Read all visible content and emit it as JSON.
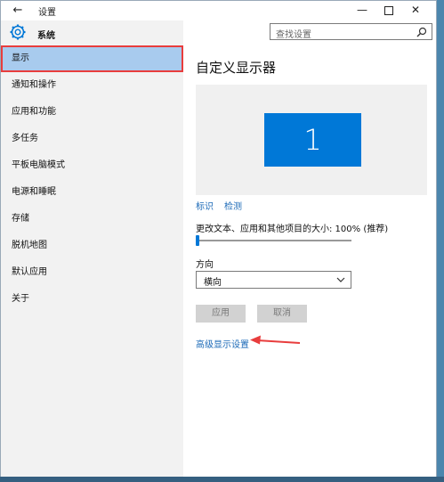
{
  "window": {
    "title": "设置",
    "back_icon": "arrow-left-icon",
    "controls": {
      "minimize": "—",
      "close": "✕"
    }
  },
  "sidebar": {
    "section_title": "系统",
    "section_icon": "gear-icon",
    "items": [
      {
        "label": "显示",
        "selected": true
      },
      {
        "label": "通知和操作"
      },
      {
        "label": "应用和功能"
      },
      {
        "label": "多任务"
      },
      {
        "label": "平板电脑模式"
      },
      {
        "label": "电源和睡眠"
      },
      {
        "label": "存储"
      },
      {
        "label": "脱机地图"
      },
      {
        "label": "默认应用"
      },
      {
        "label": "关于"
      }
    ]
  },
  "search": {
    "placeholder": "查找设置"
  },
  "main": {
    "title": "自定义显示器",
    "monitor_number": "1",
    "links": {
      "identify": "标识",
      "detect": "检测"
    },
    "scale_label": "更改文本、应用和其他项目的大小: 100% (推荐)",
    "scale_value_percent": 100,
    "orientation_label": "方向",
    "orientation_value": "横向",
    "apply_label": "应用",
    "cancel_label": "取消",
    "advanced_link": "高级显示设置"
  },
  "colors": {
    "accent": "#0078d7",
    "selected_bg": "#a8cbee",
    "highlight_border": "#e83d3d",
    "annotation_arrow": "#e83d3d"
  }
}
